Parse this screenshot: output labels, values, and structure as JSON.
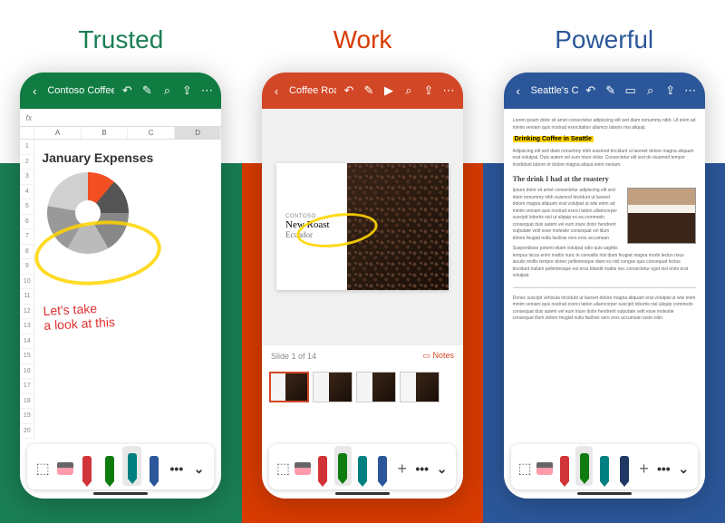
{
  "columns": [
    {
      "heading": "Trusted",
      "app": "excel"
    },
    {
      "heading": "Work",
      "app": "powerpoint"
    },
    {
      "heading": "Powerful",
      "app": "word"
    }
  ],
  "excel": {
    "title": "Contoso Coffee Expenses",
    "fx": "fx",
    "cols": [
      "",
      "A",
      "B",
      "C",
      "D"
    ],
    "rows": [
      "1",
      "2",
      "3",
      "4",
      "5",
      "6",
      "7",
      "8",
      "9",
      "10",
      "11",
      "12",
      "13",
      "14",
      "15",
      "16",
      "17",
      "18",
      "19",
      "20"
    ],
    "sheet_heading": "January Expenses",
    "note_line1": "Let's take",
    "note_line2": "a look at this",
    "tools": {
      "more": "•••",
      "chevron": "⌄"
    }
  },
  "ppt": {
    "title": "Coffee Roaster",
    "slide_overline": "CONTOSO",
    "slide_title": "New Roast",
    "slide_sub": "Ecuador",
    "counter": "Slide 1 of 14",
    "notes_label": "Notes",
    "tools": {
      "plus": "+",
      "more": "•••",
      "chevron": "⌄"
    }
  },
  "word": {
    "title": "Seattle's Coffee Culture",
    "highlight": "Drinking Coffee in Seattle",
    "h2": "The drink I had at the roastery",
    "tools": {
      "plus": "+",
      "more": "•••",
      "chevron": "⌄"
    }
  },
  "header_icons": {
    "back": "‹",
    "undo": "↶",
    "draw": "✎",
    "play": "▶",
    "device": "▭",
    "search": "⌕",
    "share": "⇪",
    "more": "⋯"
  }
}
